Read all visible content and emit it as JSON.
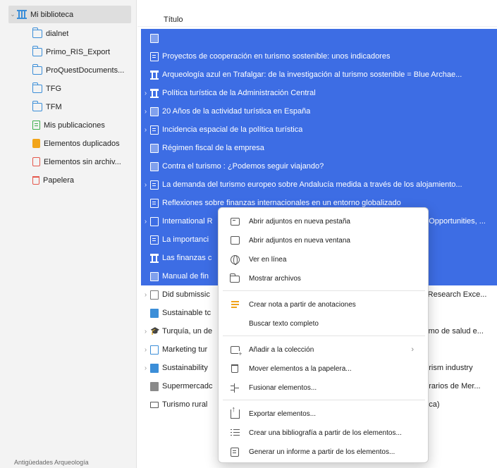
{
  "sidebar": {
    "root": {
      "label": "Mi biblioteca",
      "icon": "library-icon"
    },
    "items": [
      {
        "label": "dialnet",
        "icon": "folder-icon"
      },
      {
        "label": "Primo_RIS_Export",
        "icon": "folder-icon"
      },
      {
        "label": "ProQuestDocuments...",
        "icon": "folder-icon"
      },
      {
        "label": "TFG",
        "icon": "folder-icon"
      },
      {
        "label": "TFM",
        "icon": "folder-icon"
      },
      {
        "label": "Mis publicaciones",
        "icon": "my-publications-icon"
      },
      {
        "label": "Elementos duplicados",
        "icon": "duplicate-items-icon"
      },
      {
        "label": "Elementos sin archiv...",
        "icon": "unfiled-items-icon"
      },
      {
        "label": "Papelera",
        "icon": "trash-icon"
      }
    ],
    "tag_bar": "Antigüedades Arqueología"
  },
  "items_pane": {
    "column_title": "Título",
    "rows": [
      {
        "title": "",
        "icon": "book",
        "selected": true,
        "expandable": false
      },
      {
        "title": "Proyectos de cooperación en turismo sostenible: unos indicadores",
        "icon": "doc",
        "selected": true,
        "expandable": false
      },
      {
        "title": "Arqueología azul en Trafalgar: de la investigación al turismo sostenible = Blue Archae...",
        "icon": "temple",
        "selected": true,
        "expandable": false
      },
      {
        "title": "Política turística de la Administración Central",
        "icon": "temple",
        "selected": true,
        "expandable": true
      },
      {
        "title": "20 Años de la actividad turística en España",
        "icon": "book",
        "selected": true,
        "expandable": true
      },
      {
        "title": "Incidencia espacial de la política turística",
        "icon": "doc",
        "selected": true,
        "expandable": true
      },
      {
        "title": "Régimen fiscal de la empresa",
        "icon": "book",
        "selected": true,
        "expandable": false
      },
      {
        "title": "Contra el turismo : ¿Podemos seguir viajando?",
        "icon": "book",
        "selected": true,
        "expandable": false
      },
      {
        "title": "La demanda del turismo europeo sobre Andalucía medida a través de los alojamiento...",
        "icon": "doc",
        "selected": true,
        "expandable": true
      },
      {
        "title": "Reflexiones sobre finanzas internacionales en un entorno globalizado",
        "icon": "doc",
        "selected": true,
        "expandable": false
      },
      {
        "title": "International R",
        "title_tail": "of Opportunities, ...",
        "icon": "report",
        "selected": true,
        "expandable": true
      },
      {
        "title": "La importanci",
        "icon": "doc",
        "selected": true,
        "expandable": false
      },
      {
        "title": "Las finanzas c",
        "icon": "temple",
        "selected": true,
        "expandable": false
      },
      {
        "title": "Manual de fin",
        "icon": "book",
        "selected": true,
        "expandable": false
      },
      {
        "title": "Did submissic",
        "title_tail": "'s Research Exce...",
        "icon": "doc",
        "selected": false,
        "expandable": true
      },
      {
        "title": "Sustainable tc",
        "icon": "book",
        "selected": false,
        "expandable": false
      },
      {
        "title": "Turquía, un de",
        "title_tail": "rismo de salud e...",
        "icon": "cap",
        "selected": false,
        "expandable": true
      },
      {
        "title": "Marketing tur",
        "icon": "multi",
        "selected": false,
        "expandable": true
      },
      {
        "title": "Sustainability",
        "title_tail": "ourism industry",
        "icon": "book",
        "selected": false,
        "expandable": true
      },
      {
        "title": "Supermercadc",
        "title_tail": "horarios de Mer...",
        "icon": "news",
        "selected": false,
        "expandable": false
      },
      {
        "title": "Turismo rural",
        "title_tail": "enca)",
        "icon": "film",
        "selected": false,
        "expandable": false
      }
    ]
  },
  "context_menu": {
    "items": [
      {
        "label": "Abrir adjuntos en nueva pestaña",
        "icon": "new-tab-icon"
      },
      {
        "label": "Abrir adjuntos en nueva ventana",
        "icon": "new-window-icon"
      },
      {
        "label": "Ver en línea",
        "icon": "globe-icon"
      },
      {
        "label": "Mostrar archivos",
        "icon": "folder-icon"
      },
      {
        "label": "Crear nota a partir de anotaciones",
        "icon": "note-icon"
      },
      {
        "label": "Buscar texto completo",
        "icon": ""
      },
      {
        "label": "Añadir a la colección",
        "icon": "add-collection-icon",
        "submenu": true
      },
      {
        "label": "Mover elementos a la papelera...",
        "icon": "trash-icon"
      },
      {
        "label": "Fusionar elementos...",
        "icon": "merge-icon"
      },
      {
        "label": "Exportar elementos...",
        "icon": "export-icon"
      },
      {
        "label": "Crear una bibliografía a partir de los elementos...",
        "icon": "bibliography-icon"
      },
      {
        "label": "Generar un informe a partir de los elementos...",
        "icon": "report-icon"
      }
    ],
    "submenu_arrow": "›"
  },
  "colors": {
    "selection": "#3d6de4",
    "sidebar_bg": "#f3f3f3",
    "folder": "#3b8ed8"
  }
}
